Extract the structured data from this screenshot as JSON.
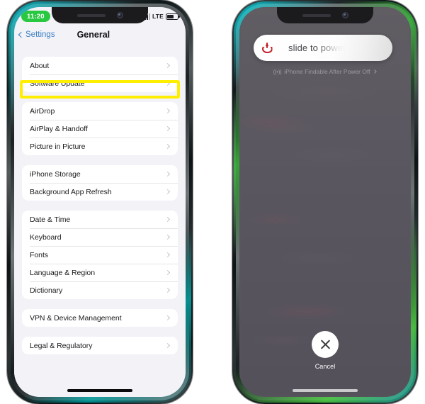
{
  "left_phone": {
    "status_bar": {
      "time": "11:20",
      "network_label": "LTE",
      "signal_icon": "signal-bars-icon",
      "battery_icon": "battery-icon"
    },
    "nav": {
      "back_label": "Settings",
      "back_icon": "chevron-left-icon",
      "title": "General"
    },
    "groups": [
      {
        "rows": [
          {
            "label": "About",
            "chevron": "chevron-right-icon",
            "highlighted": false
          },
          {
            "label": "Software Update",
            "chevron": "chevron-right-icon",
            "highlighted": true
          }
        ]
      },
      {
        "rows": [
          {
            "label": "AirDrop",
            "chevron": "chevron-right-icon",
            "highlighted": false
          },
          {
            "label": "AirPlay & Handoff",
            "chevron": "chevron-right-icon",
            "highlighted": false
          },
          {
            "label": "Picture in Picture",
            "chevron": "chevron-right-icon",
            "highlighted": false
          }
        ]
      },
      {
        "rows": [
          {
            "label": "iPhone Storage",
            "chevron": "chevron-right-icon",
            "highlighted": false
          },
          {
            "label": "Background App Refresh",
            "chevron": "chevron-right-icon",
            "highlighted": false
          }
        ]
      },
      {
        "rows": [
          {
            "label": "Date & Time",
            "chevron": "chevron-right-icon",
            "highlighted": false
          },
          {
            "label": "Keyboard",
            "chevron": "chevron-right-icon",
            "highlighted": false
          },
          {
            "label": "Fonts",
            "chevron": "chevron-right-icon",
            "highlighted": false
          },
          {
            "label": "Language & Region",
            "chevron": "chevron-right-icon",
            "highlighted": false
          },
          {
            "label": "Dictionary",
            "chevron": "chevron-right-icon",
            "highlighted": false
          }
        ]
      },
      {
        "rows": [
          {
            "label": "VPN & Device Management",
            "chevron": "chevron-right-icon",
            "highlighted": false
          }
        ]
      },
      {
        "rows": [
          {
            "label": "Legal & Regulatory",
            "chevron": "chevron-right-icon",
            "highlighted": false
          }
        ]
      }
    ],
    "highlight_color": "#ffee00"
  },
  "right_phone": {
    "slider": {
      "text": "slide to power off",
      "power_icon": "power-icon",
      "power_icon_color": "#c41e28"
    },
    "findable": {
      "icon": "((•))",
      "text": "iPhone Findable After Power Off",
      "chevron": "chevron-right-icon"
    },
    "cancel": {
      "label": "Cancel",
      "icon": "close-x-icon"
    }
  }
}
